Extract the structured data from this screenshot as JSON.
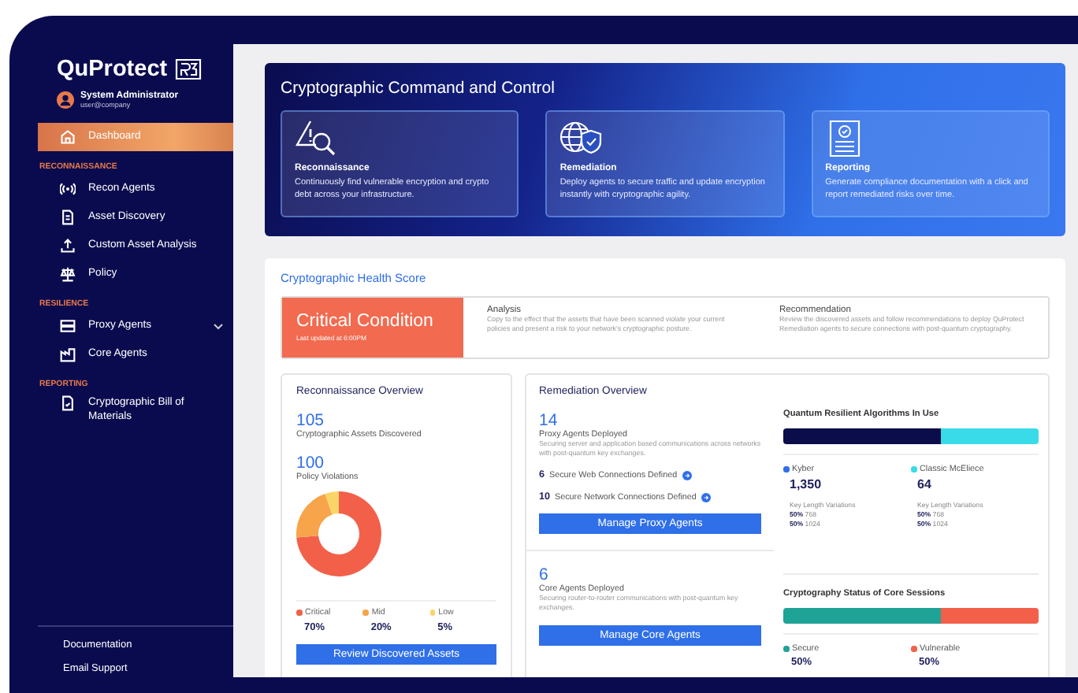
{
  "app": {
    "logo": "QuProtect",
    "user": {
      "name": "System Administrator",
      "email": "user@company"
    }
  },
  "sidebar": {
    "items": [
      {
        "label": "Dashboard",
        "selected": true,
        "expandable": false
      }
    ],
    "sections": [
      {
        "heading": "RECONNAISSANCE",
        "items": [
          {
            "label": "Recon Agents",
            "selected": false,
            "expandable": false
          },
          {
            "label": "Asset Discovery",
            "selected": false,
            "expandable": false
          },
          {
            "label": "Custom Asset Analysis",
            "selected": false,
            "expandable": false
          },
          {
            "label": "Policy",
            "selected": false,
            "expandable": false
          }
        ]
      },
      {
        "heading": "RESILIENCE",
        "items": [
          {
            "label": "Proxy Agents",
            "selected": false,
            "expandable": true
          },
          {
            "label": "Core Agents",
            "selected": false,
            "expandable": false
          }
        ]
      },
      {
        "heading": "REPORTING",
        "items": [
          {
            "label": "Cryptographic Bill of Materials",
            "selected": false,
            "expandable": false
          }
        ]
      }
    ],
    "footer": [
      "Documentation",
      "Email Support"
    ]
  },
  "hero": {
    "title": "Cryptographic Command and Control",
    "cards": [
      {
        "title": "Reconnaissance",
        "text": "Continuously find vulnerable encryption and crypto debt across your infrastructure."
      },
      {
        "title": "Remediation",
        "text": "Deploy agents to secure traffic and update encryption instantly with cryptographic agility."
      },
      {
        "title": "Reporting",
        "text": "Generate compliance documentation with a click and report remediated risks over time."
      }
    ]
  },
  "health": {
    "title": "Cryptographic Health Score",
    "status": {
      "label": "Critical Condition",
      "updated": "Last updated at 6:00PM"
    },
    "notes": [
      {
        "heading": "Analysis",
        "text": "Copy to the effect that the assets that have been scanned violate your current policies and present a risk to your network's cryptographic posture."
      },
      {
        "heading": "Recommendation",
        "text": "Review the discovered assets and follow recommendations to deploy QuProtect Remediation agents to secure connections with post-quantum cryptography."
      }
    ]
  },
  "recon": {
    "title": "Reconnaissance Overview",
    "stats": [
      {
        "value": "105",
        "label": "Cryptographic Assets Discovered"
      },
      {
        "value": "100",
        "label": "Policy Violations"
      }
    ],
    "legend": [
      {
        "label": "Critical",
        "value": "70%",
        "color": "#f2604a"
      },
      {
        "label": "Mid",
        "value": "20%",
        "color": "#f7a44a"
      },
      {
        "label": "Low",
        "value": "5%",
        "color": "#fbd468"
      }
    ],
    "button": "Review Discovered Assets"
  },
  "remediation": {
    "title": "Remediation Overview",
    "proxy": {
      "value": "14",
      "label": "Proxy Agents Deployed",
      "description": "Securing server and application based communications across networks with post-quantum key exchanges.",
      "links": [
        {
          "count": "6",
          "label": "Secure Web Connections Defined"
        },
        {
          "count": "10",
          "label": "Secure Network Connections Defined"
        }
      ],
      "button": "Manage Proxy Agents"
    },
    "core": {
      "value": "6",
      "label": "Core Agents Deployed",
      "description": "Securing router-to-router communications with post-quantum key exchanges.",
      "button": "Manage Core Agents"
    },
    "algorithms": {
      "title": "Quantum Resilient Algorithms In Use",
      "level": 0.62,
      "items": [
        {
          "name": "Kyber",
          "color": "#2f6fe8",
          "count": "1,350",
          "variations_label": "Key Length Variations",
          "variations": [
            {
              "share": "50%",
              "length": "768"
            },
            {
              "share": "50%",
              "length": "1024"
            }
          ]
        },
        {
          "name": "Classic McEliece",
          "color": "#3adbe8",
          "count": "64",
          "variations_label": "Key Length Variations",
          "variations": [
            {
              "share": "50%",
              "length": "768"
            },
            {
              "share": "50%",
              "length": "1024"
            }
          ]
        }
      ]
    },
    "sessions": {
      "title": "Cryptography Status of Core Sessions",
      "level": 0.62,
      "items": [
        {
          "name": "Secure",
          "color": "#1fa396",
          "value": "50%"
        },
        {
          "name": "Vulnerable",
          "color": "#f2604a",
          "value": "50%"
        }
      ]
    }
  }
}
